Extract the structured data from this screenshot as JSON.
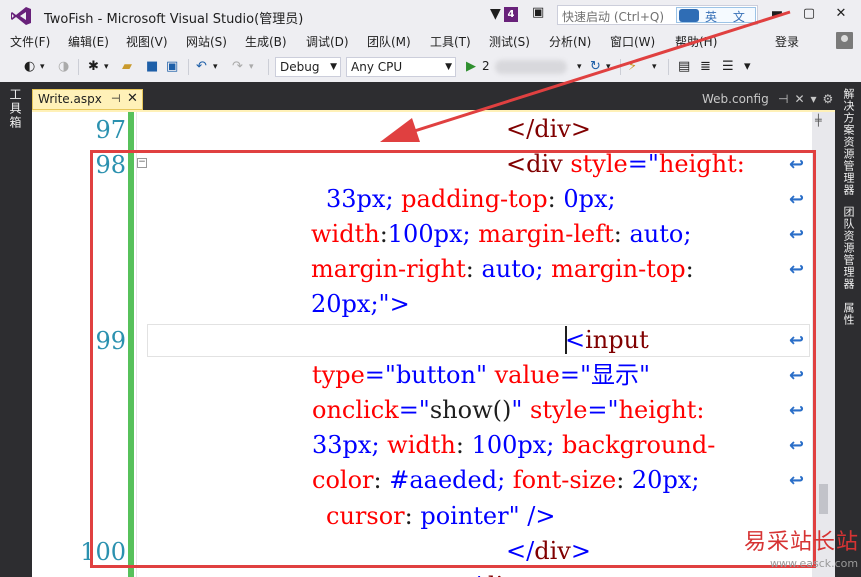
{
  "title_bar": {
    "app_title": "TwoFish - Microsoft Visual Studio(管理员)",
    "notification_count": "4",
    "quick_launch_placeholder": "快速启动 (Ctrl+Q)",
    "ime_text": "英 文",
    "accent_color": "#68217a"
  },
  "menu": {
    "items": [
      "文件(F)",
      "编辑(E)",
      "视图(V)",
      "网站(S)",
      "生成(B)",
      "调试(D)",
      "团队(M)",
      "工具(T)",
      "测试(S)",
      "分析(N)",
      "窗口(W)",
      "帮助(H)"
    ],
    "login": "登录"
  },
  "toolbar": {
    "config": "Debug",
    "platform": "Any CPU",
    "run_label": "2"
  },
  "side_panels": {
    "left": "工具箱",
    "right": [
      "解决方案资源管理器",
      "团队资源管理器",
      "属性"
    ]
  },
  "tabs": {
    "active": "Write.aspx",
    "pin_icon": "pin-icon",
    "right": "Web.config"
  },
  "editor": {
    "line_numbers": [
      "97",
      "98",
      "99",
      "100"
    ],
    "code_lines": [
      {
        "n": "97",
        "segments": [
          {
            "t": "</",
            "c": "tag"
          },
          {
            "t": "div",
            "c": "tag"
          },
          {
            "t": ">",
            "c": "tag"
          }
        ]
      },
      {
        "n": "98",
        "segments": [
          {
            "t": "<",
            "c": "tag"
          },
          {
            "t": "div",
            "c": "tag"
          },
          {
            "t": " style",
            "c": "attr"
          },
          {
            "t": "=\"",
            "c": "str"
          },
          {
            "t": "height:",
            "c": "attr"
          }
        ]
      },
      {
        "n": "",
        "segments": [
          {
            "t": "33px; ",
            "c": "str"
          },
          {
            "t": "padding-top",
            "c": "attr"
          },
          {
            "t": ": ",
            "c": "blk"
          },
          {
            "t": "0px;",
            "c": "str"
          }
        ]
      },
      {
        "n": "",
        "segments": [
          {
            "t": "width",
            "c": "attr"
          },
          {
            "t": ":",
            "c": "blk"
          },
          {
            "t": "100px; ",
            "c": "str"
          },
          {
            "t": "margin-left",
            "c": "attr"
          },
          {
            "t": ": ",
            "c": "blk"
          },
          {
            "t": "auto;",
            "c": "str"
          }
        ]
      },
      {
        "n": "",
        "segments": [
          {
            "t": "margin-right",
            "c": "attr"
          },
          {
            "t": ": ",
            "c": "blk"
          },
          {
            "t": "auto; ",
            "c": "str"
          },
          {
            "t": "margin-top",
            "c": "attr"
          },
          {
            "t": ":",
            "c": "blk"
          }
        ]
      },
      {
        "n": "",
        "segments": [
          {
            "t": "20px;",
            "c": "str"
          },
          {
            "t": "\"",
            "c": "str"
          },
          {
            "t": ">",
            "c": "str"
          }
        ]
      },
      {
        "n": "99",
        "segments": [
          {
            "t": "<",
            "c": "str"
          },
          {
            "t": "input",
            "c": "tag"
          }
        ]
      },
      {
        "n": "",
        "segments": [
          {
            "t": "type",
            "c": "attr"
          },
          {
            "t": "=\"",
            "c": "str"
          },
          {
            "t": "button",
            "c": "str"
          },
          {
            "t": "\" ",
            "c": "str"
          },
          {
            "t": "value",
            "c": "attr"
          },
          {
            "t": "=\"",
            "c": "str"
          },
          {
            "t": "显示",
            "c": "str"
          },
          {
            "t": "\"",
            "c": "str"
          }
        ]
      },
      {
        "n": "",
        "segments": [
          {
            "t": "onclick",
            "c": "attr"
          },
          {
            "t": "=\"",
            "c": "str"
          },
          {
            "t": "show()",
            "c": "blk"
          },
          {
            "t": "\" ",
            "c": "str"
          },
          {
            "t": "style",
            "c": "attr"
          },
          {
            "t": "=\"",
            "c": "str"
          },
          {
            "t": "height:",
            "c": "attr"
          }
        ]
      },
      {
        "n": "",
        "segments": [
          {
            "t": "33px; ",
            "c": "str"
          },
          {
            "t": "width",
            "c": "attr"
          },
          {
            "t": ": ",
            "c": "blk"
          },
          {
            "t": "100px; ",
            "c": "str"
          },
          {
            "t": "background-",
            "c": "attr"
          }
        ]
      },
      {
        "n": "",
        "segments": [
          {
            "t": "color",
            "c": "attr"
          },
          {
            "t": ": ",
            "c": "blk"
          },
          {
            "t": "#aaeded; ",
            "c": "str"
          },
          {
            "t": "font-size",
            "c": "attr"
          },
          {
            "t": ": ",
            "c": "blk"
          },
          {
            "t": "20px;",
            "c": "str"
          }
        ]
      },
      {
        "n": "",
        "segments": [
          {
            "t": "cursor",
            "c": "attr"
          },
          {
            "t": ": ",
            "c": "blk"
          },
          {
            "t": "pointer",
            "c": "str"
          },
          {
            "t": "\" ",
            "c": "str"
          },
          {
            "t": "/>",
            "c": "str"
          }
        ]
      },
      {
        "n": "100",
        "segments": [
          {
            "t": "</",
            "c": "str"
          },
          {
            "t": "div",
            "c": "tag"
          },
          {
            "t": ">",
            "c": "str"
          }
        ]
      },
      {
        "n": "",
        "segments": [
          {
            "t": "</",
            "c": "str"
          },
          {
            "t": "div",
            "c": "tag"
          },
          {
            "t": ">",
            "c": "str"
          }
        ]
      }
    ]
  },
  "watermark": {
    "text": "易采站长站",
    "url": "www.easck.com"
  },
  "colors": {
    "annotation_red": "#e04040",
    "change_bar_green": "#57c15b",
    "line_number": "#2b91af"
  }
}
